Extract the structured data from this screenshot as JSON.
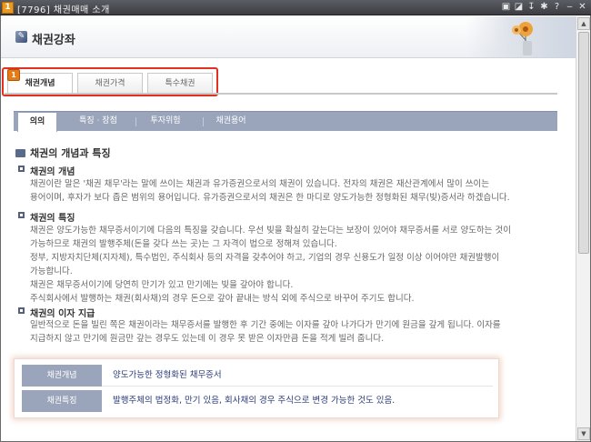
{
  "window": {
    "app_badge": "1",
    "title": "[7796] 채권매매 소개",
    "controls": [
      "▣",
      "◪",
      "↧",
      "✱",
      "?",
      "‒",
      "✕"
    ]
  },
  "header": {
    "title": "채권강좌",
    "icon": "book-icon"
  },
  "main_tabs": [
    {
      "label": "채권개념",
      "active": true,
      "badge": "1"
    },
    {
      "label": "채권가격",
      "active": false
    },
    {
      "label": "특수채권",
      "active": false
    }
  ],
  "sub_tabs": [
    {
      "label": "의의",
      "active": true
    },
    {
      "label": "특징 · 장점",
      "active": false
    },
    {
      "label": "투자위험",
      "active": false
    },
    {
      "label": "채권용어",
      "active": false
    }
  ],
  "content": {
    "section_title": "채권의 개념과 특징",
    "items": [
      {
        "heading": "채권의 개념",
        "lines": [
          "채권이란 말은 '채권 채무'라는 말에 쓰이는 채권과 유가증권으로서의 채권이 있습니다. 전자의 채권은 재산관계에서 많이 쓰이는",
          "용어이며, 후자가 보다 좁은 범위의 용어입니다. 유가증권으로서의 채권은 한 마디로 양도가능한 정형화된 채무(빚)증서라 하겠습니다."
        ]
      },
      {
        "heading": "채권의 특징",
        "lines": [
          "채권은 양도가능한 채무증서이기에 다음의 특징을 갖습니다. 우선 빚을 확실히 갚는다는 보장이 있어야 채무증서를 서로 양도하는 것이",
          "가능하므로 채권의 발행주체(돈을 갖다 쓰는 곳)는 그 자격이 법으로 정해져 있습니다.",
          "정부, 지방자치단체(지자체), 특수법인, 주식회사 등의 자격을 갖추어야 하고, 기업의 경우 신용도가 일정 이상 이어야만 채권발행이",
          "가능합니다.",
          "채권은 채무증서이기에 당연히 만기가 있고 만기에는 빚을 갚아야 합니다.",
          "주식회사에서 발행하는 채권(회사채)의 경우 돈으로 갚아 끝내는 방식 외에 주식으로 바꾸어 주기도 합니다."
        ]
      },
      {
        "heading": "채권의 이자 지급",
        "lines": [
          "일반적으로 돈을 빌린 쪽은 채권이라는 채무증서를 발행한 후 기간 중에는 이자를 갚아 나가다가 만기에 원금을 갚게 됩니다. 이자를",
          "지급하지 않고 만기에 원금만 갚는 경우도 있는데 이 경우 못 받은 이자만큼 돈을 적게 빌려 줍니다."
        ]
      }
    ]
  },
  "summary": [
    {
      "label": "채권개념",
      "value": "양도가능한 정형화된 채무증서"
    },
    {
      "label": "채권특징",
      "value": "발행주체의 법정화, 만기 있음, 회사채의 경우 주식으로 변경 가능한 것도 있음."
    }
  ],
  "colors": {
    "highlight_border": "#e0321f",
    "subtab_bg": "#9aa5bb",
    "summary_value": "#2a3a78"
  }
}
